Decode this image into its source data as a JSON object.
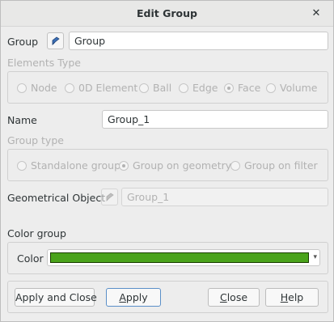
{
  "window": {
    "title": "Edit Group",
    "close_glyph": "✕"
  },
  "group": {
    "label": "Group",
    "value": "Group"
  },
  "elements_type": {
    "title": "Elements Type",
    "options": [
      "Node",
      "0D Element",
      "Ball",
      "Edge",
      "Face",
      "Volume"
    ],
    "selected": "Face",
    "enabled": false
  },
  "name": {
    "label": "Name",
    "value": "Group_1"
  },
  "group_type": {
    "title": "Group type",
    "options": [
      "Standalone group",
      "Group on geometry",
      "Group on filter"
    ],
    "selected": "Group on geometry",
    "enabled": false
  },
  "geometrical_object": {
    "label": "Geometrical Object",
    "value": "Group_1",
    "enabled": false
  },
  "color_group": {
    "title": "Color group",
    "color_label": "Color",
    "color_value": "#4aa31b"
  },
  "buttons": {
    "apply_close": "Apply and Close",
    "apply_first": "A",
    "apply_rest": "pply",
    "close_first": "C",
    "close_rest": "lose",
    "help_first": "H",
    "help_rest": "elp"
  },
  "icons": {
    "selection_arrow": "selection-arrow-icon"
  }
}
